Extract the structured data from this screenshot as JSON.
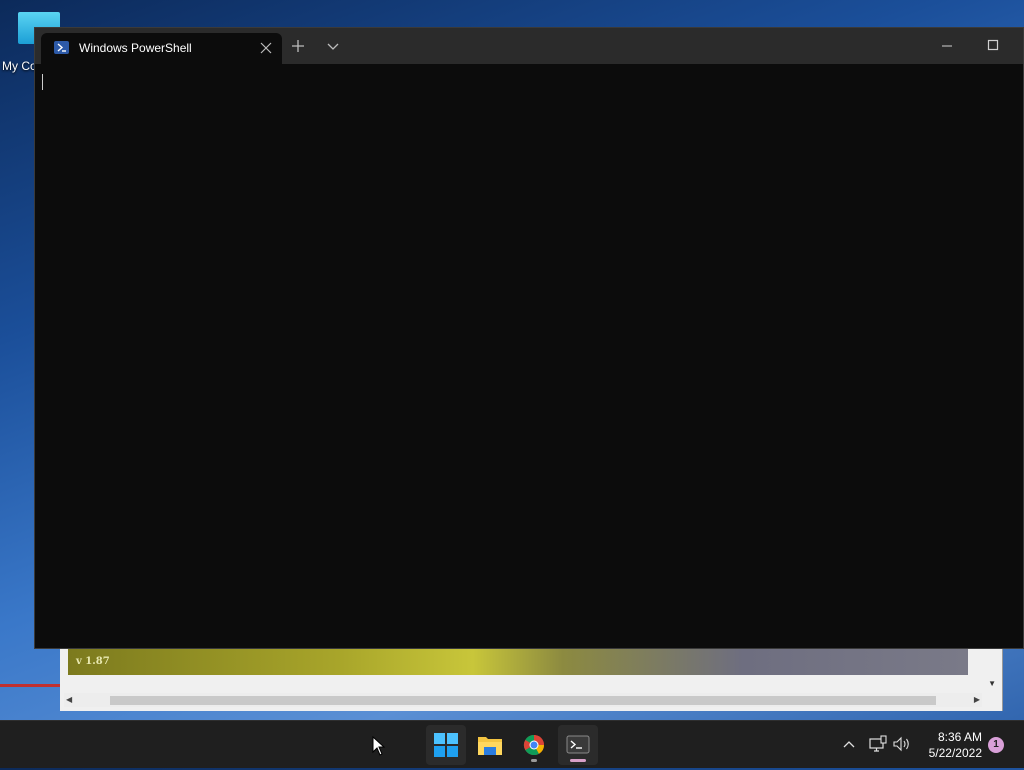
{
  "desktop": {
    "icon_label": "My Computer"
  },
  "background_window": {
    "banner_text": "v 1.87"
  },
  "terminal": {
    "tab_title": "Windows PowerShell",
    "icons": {
      "tab": "powershell-icon",
      "close": "close-icon",
      "new_tab": "plus-icon",
      "dropdown": "chevron-down-icon",
      "minimize": "minimize-icon",
      "maximize": "maximize-icon"
    },
    "colors": {
      "background": "#0c0c0c",
      "titlebar": "#2b2b2b"
    }
  },
  "taskbar": {
    "apps": [
      {
        "name": "Start",
        "icon": "windows-start-icon"
      },
      {
        "name": "File Explorer",
        "icon": "folder-icon"
      },
      {
        "name": "Google Chrome",
        "icon": "chrome-icon"
      },
      {
        "name": "Terminal",
        "icon": "terminal-icon"
      }
    ],
    "tray": {
      "chevron": "chevron-up-icon",
      "network": "network-icon",
      "volume": "volume-icon"
    },
    "clock": {
      "time": "8:36 AM",
      "date": "5/22/2022"
    },
    "notification_count": "1"
  }
}
